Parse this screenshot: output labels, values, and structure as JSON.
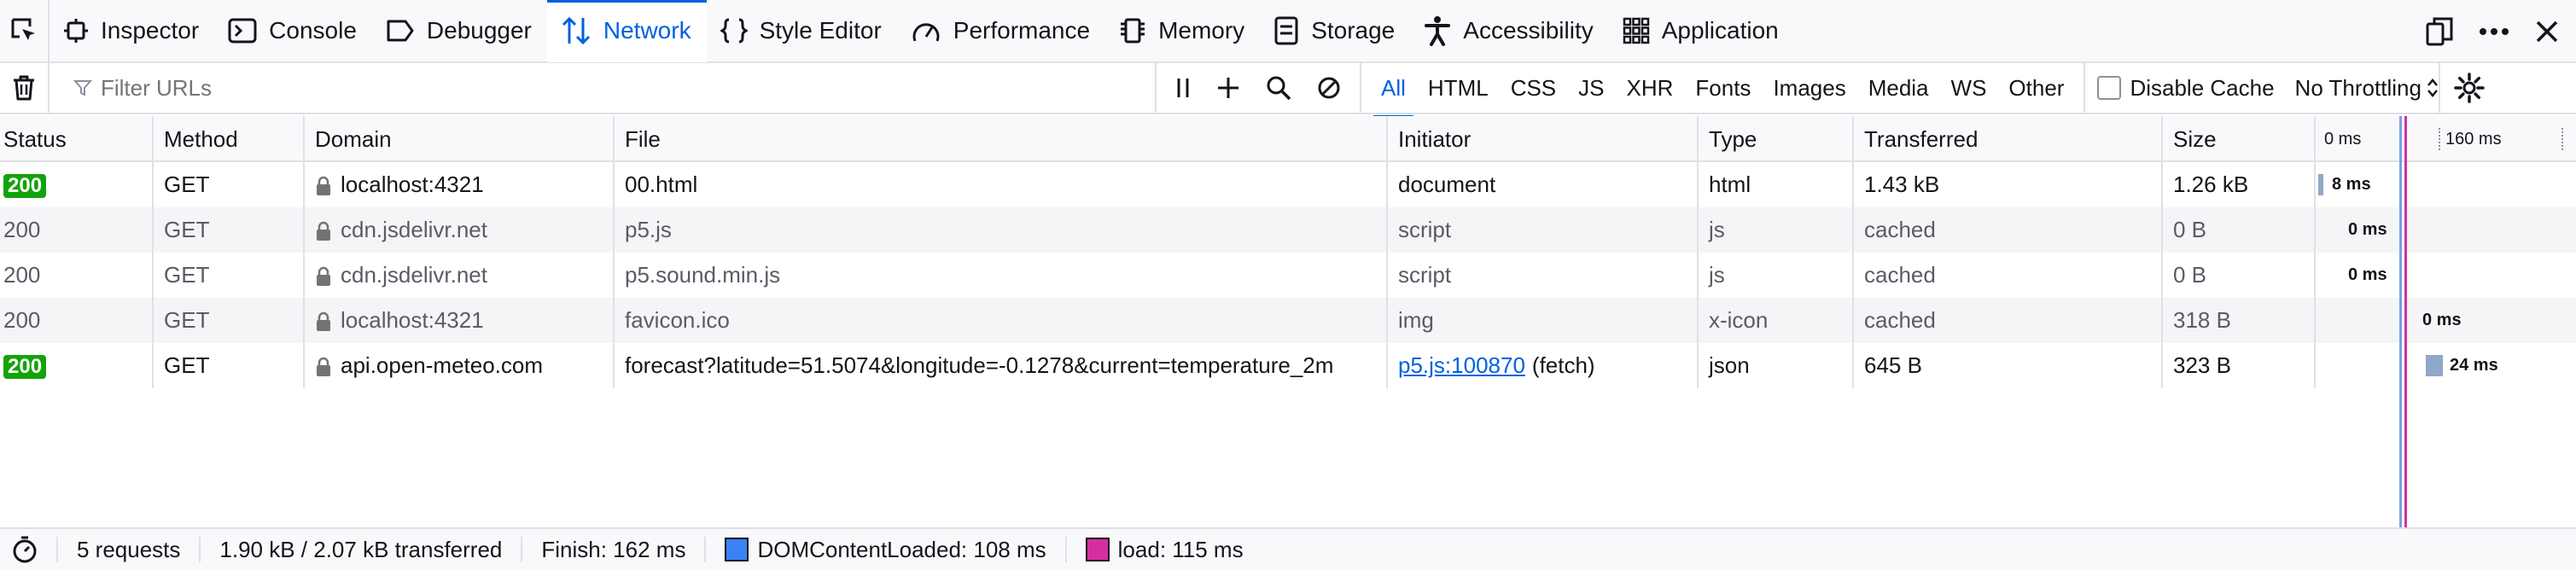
{
  "toolbar": {
    "tabs": [
      {
        "label": "Inspector"
      },
      {
        "label": "Console"
      },
      {
        "label": "Debugger"
      },
      {
        "label": "Network"
      },
      {
        "label": "Style Editor"
      },
      {
        "label": "Performance"
      },
      {
        "label": "Memory"
      },
      {
        "label": "Storage"
      },
      {
        "label": "Accessibility"
      },
      {
        "label": "Application"
      }
    ],
    "active_tab": "Network"
  },
  "filter": {
    "placeholder": "Filter URLs",
    "types": [
      "All",
      "HTML",
      "CSS",
      "JS",
      "XHR",
      "Fonts",
      "Images",
      "Media",
      "WS",
      "Other"
    ],
    "active_type": "All",
    "disable_cache_label": "Disable Cache",
    "disable_cache_checked": false,
    "throttling": "No Throttling"
  },
  "table": {
    "columns": [
      "Status",
      "Method",
      "Domain",
      "File",
      "Initiator",
      "Type",
      "Transferred",
      "Size"
    ],
    "waterfall_ticks": [
      "0 ms",
      "160 ms"
    ],
    "rows": [
      {
        "status": "200",
        "method": "GET",
        "domain": "localhost:4321",
        "file": "00.html",
        "initiator": "document",
        "initiator_suffix": "",
        "type": "html",
        "transferred": "1.43 kB",
        "size": "1.26 kB",
        "timing": "8 ms",
        "cached": false
      },
      {
        "status": "200",
        "method": "GET",
        "domain": "cdn.jsdelivr.net",
        "file": "p5.js",
        "initiator": "script",
        "initiator_suffix": "",
        "type": "js",
        "transferred": "cached",
        "size": "0 B",
        "timing": "0 ms",
        "cached": true
      },
      {
        "status": "200",
        "method": "GET",
        "domain": "cdn.jsdelivr.net",
        "file": "p5.sound.min.js",
        "initiator": "script",
        "initiator_suffix": "",
        "type": "js",
        "transferred": "cached",
        "size": "0 B",
        "timing": "0 ms",
        "cached": true
      },
      {
        "status": "200",
        "method": "GET",
        "domain": "localhost:4321",
        "file": "favicon.ico",
        "initiator": "img",
        "initiator_suffix": "",
        "type": "x-icon",
        "transferred": "cached",
        "size": "318 B",
        "timing": "0 ms",
        "cached": true
      },
      {
        "status": "200",
        "method": "GET",
        "domain": "api.open-meteo.com",
        "file": "forecast?latitude=51.5074&longitude=-0.1278&current=temperature_2m",
        "initiator": "p5.js:100870",
        "initiator_suffix": "(fetch)",
        "type": "json",
        "transferred": "645 B",
        "size": "323 B",
        "timing": "24 ms",
        "cached": false
      }
    ]
  },
  "statusbar": {
    "requests": "5 requests",
    "transferred": "1.90 kB / 2.07 kB transferred",
    "finish": "Finish: 162 ms",
    "dom_content_loaded": "DOMContentLoaded: 108 ms",
    "load": "load: 115 ms"
  },
  "colors": {
    "accent": "#0061e0",
    "status_ok": "#12a30a",
    "dom_content_loaded": "#3b82f6",
    "load": "#d62ea0"
  }
}
